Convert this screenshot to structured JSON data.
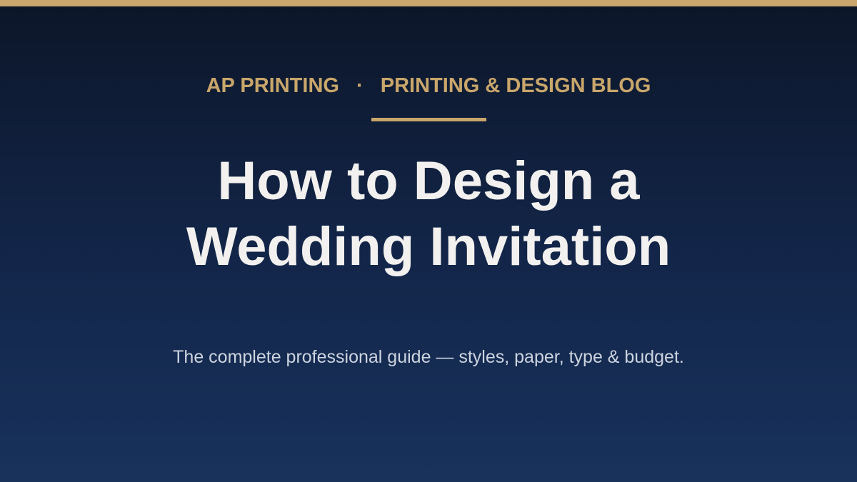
{
  "header": {
    "brand": "AP PRINTING",
    "separator": "·",
    "section": "PRINTING & DESIGN BLOG"
  },
  "title": {
    "line1": "How to Design a",
    "line2": "Wedding Invitation"
  },
  "subtitle": "The complete professional guide — styles, paper, type & budget.",
  "colors": {
    "accent": "#c9a66b",
    "background_top": "#0c1629",
    "background_bottom": "#18325c",
    "title": "#f3f1ef",
    "subtitle": "#cdd4df"
  }
}
